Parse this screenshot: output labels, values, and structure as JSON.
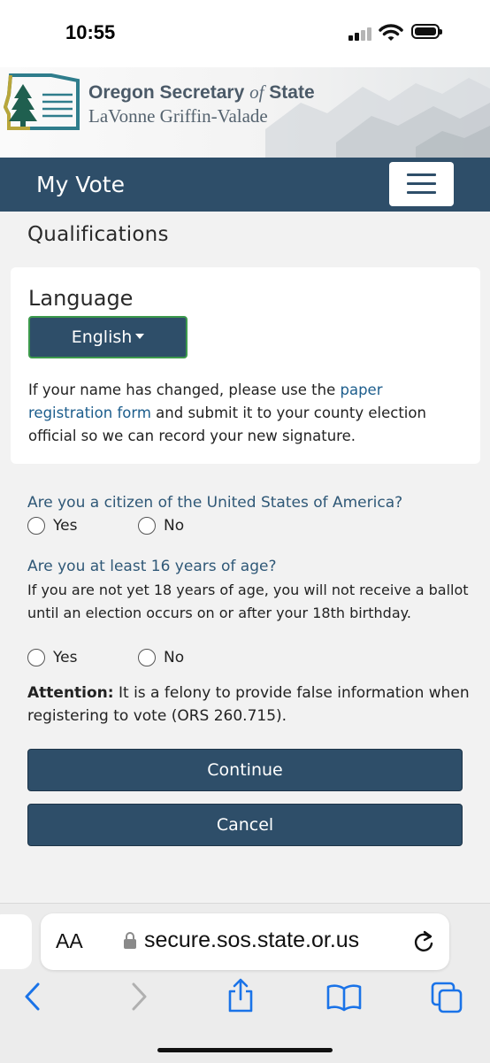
{
  "status_bar": {
    "time": "10:55"
  },
  "header": {
    "org_name_part1": "Oregon Secretary",
    "org_name_of": "of",
    "org_name_part2": "State",
    "official_name": "LaVonne Griffin-Valade"
  },
  "navbar": {
    "brand": "My Vote"
  },
  "page": {
    "title": "Qualifications"
  },
  "language_card": {
    "label": "Language",
    "selected_language": "English",
    "note_before_link": "If your name has changed, please use the ",
    "note_link": "paper registration form",
    "note_after_link": " and submit it to your county election official so we can record your new signature."
  },
  "questions": [
    {
      "text": "Are you a citizen of the United States of America?",
      "options": [
        "Yes",
        "No"
      ]
    },
    {
      "text": "Are you at least 16 years of age?",
      "hint": "If you are not yet 18 years of age, you will not receive a ballot until an election occurs on or after your 18th birthday.",
      "options": [
        "Yes",
        "No"
      ]
    }
  ],
  "attention": {
    "label": "Attention:",
    "text": " It is a felony to provide false information when registering to vote (ORS 260.715)."
  },
  "buttons": {
    "continue": "Continue",
    "cancel": "Cancel"
  },
  "browser": {
    "text_size_button": "AA",
    "url": "secure.sos.state.or.us",
    "icons": [
      "lock-icon",
      "reload-icon",
      "back-icon",
      "forward-icon",
      "share-icon",
      "bookmarks-icon",
      "tabs-icon"
    ]
  },
  "colors": {
    "brand_navy": "#2e4e69",
    "question_text": "#2f5877",
    "link": "#1c5d8c",
    "language_button_border": "#3c9a4c"
  }
}
